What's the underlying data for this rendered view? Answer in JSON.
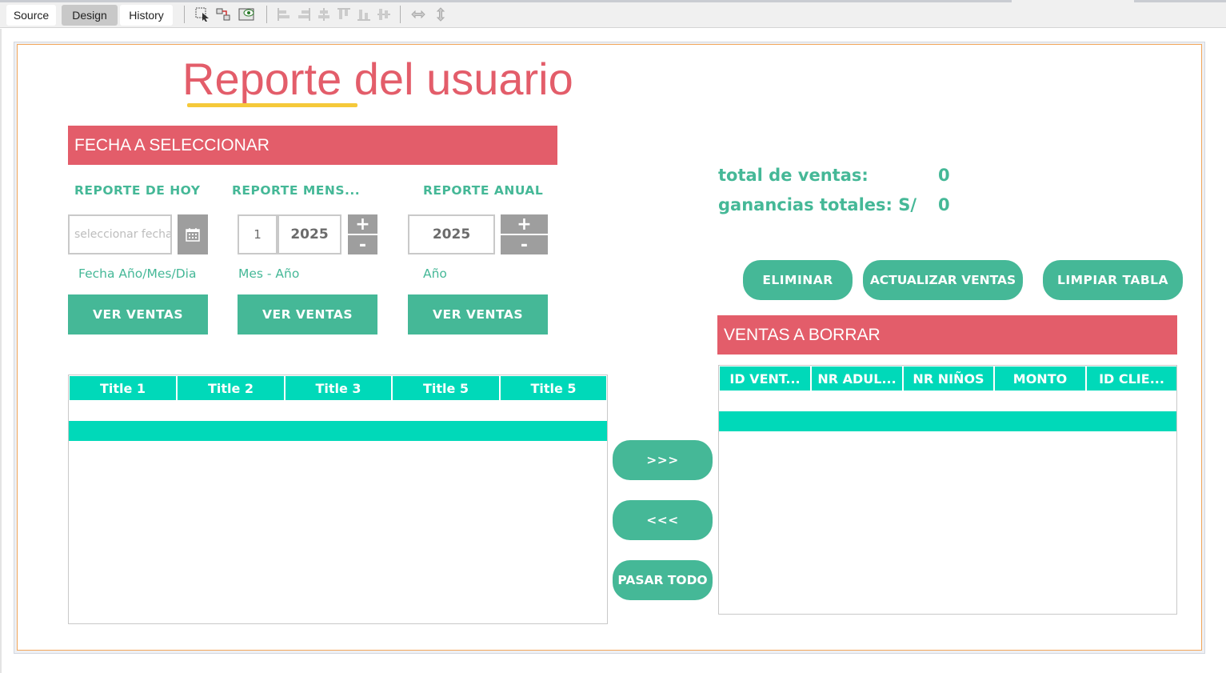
{
  "ide": {
    "tabs": [
      {
        "label": "Source"
      },
      {
        "label": "Design"
      },
      {
        "label": "History"
      }
    ]
  },
  "form": {
    "title": "Reporte del usuario",
    "date_section": {
      "banner": "FECHA  A SELECCIONAR",
      "daily": {
        "label": "REPORTE DE HOY",
        "date_placeholder": "seleccionar fecha",
        "hint": "Fecha Año/Mes/Dia",
        "button": "VER VENTAS"
      },
      "monthly": {
        "label": "REPORTE  MENS...",
        "month_value": "1",
        "year_value": "2025",
        "plus": "+",
        "minus": "-",
        "hint": "Mes  - Año",
        "button": "VER VENTAS"
      },
      "yearly": {
        "label": "REPORTE ANUAL",
        "year_value": "2025",
        "plus": "+",
        "minus": "-",
        "hint": "Año",
        "button": "VER VENTAS"
      }
    },
    "stats": {
      "total_label": "total de ventas:",
      "total_value": "0",
      "profit_label": "ganancias totales: S/",
      "profit_value": "0"
    },
    "actions": {
      "delete": "ELIMINAR",
      "update": "ACTUALIZAR VENTAS",
      "clear": "LIMPIAR TABLA"
    },
    "sales_table": {
      "columns": [
        "Title 1",
        "Title 2",
        "Title 3",
        "Title 5",
        "Title 5"
      ]
    },
    "transfer": {
      "forward": ">>>",
      "back": "<<<",
      "all": "PASAR TODO"
    },
    "delete_section": {
      "banner": "VENTAS A BORRAR",
      "columns": [
        "ID VENT...",
        "NR ADUL...",
        "NR NIÑOS",
        "MONTO",
        "ID CLIE..."
      ]
    }
  },
  "colors": {
    "accent_red": "#e35d6a",
    "accent_green": "#45b897",
    "table_teal": "#00d9b9",
    "underline_yellow": "#f5c93a"
  }
}
